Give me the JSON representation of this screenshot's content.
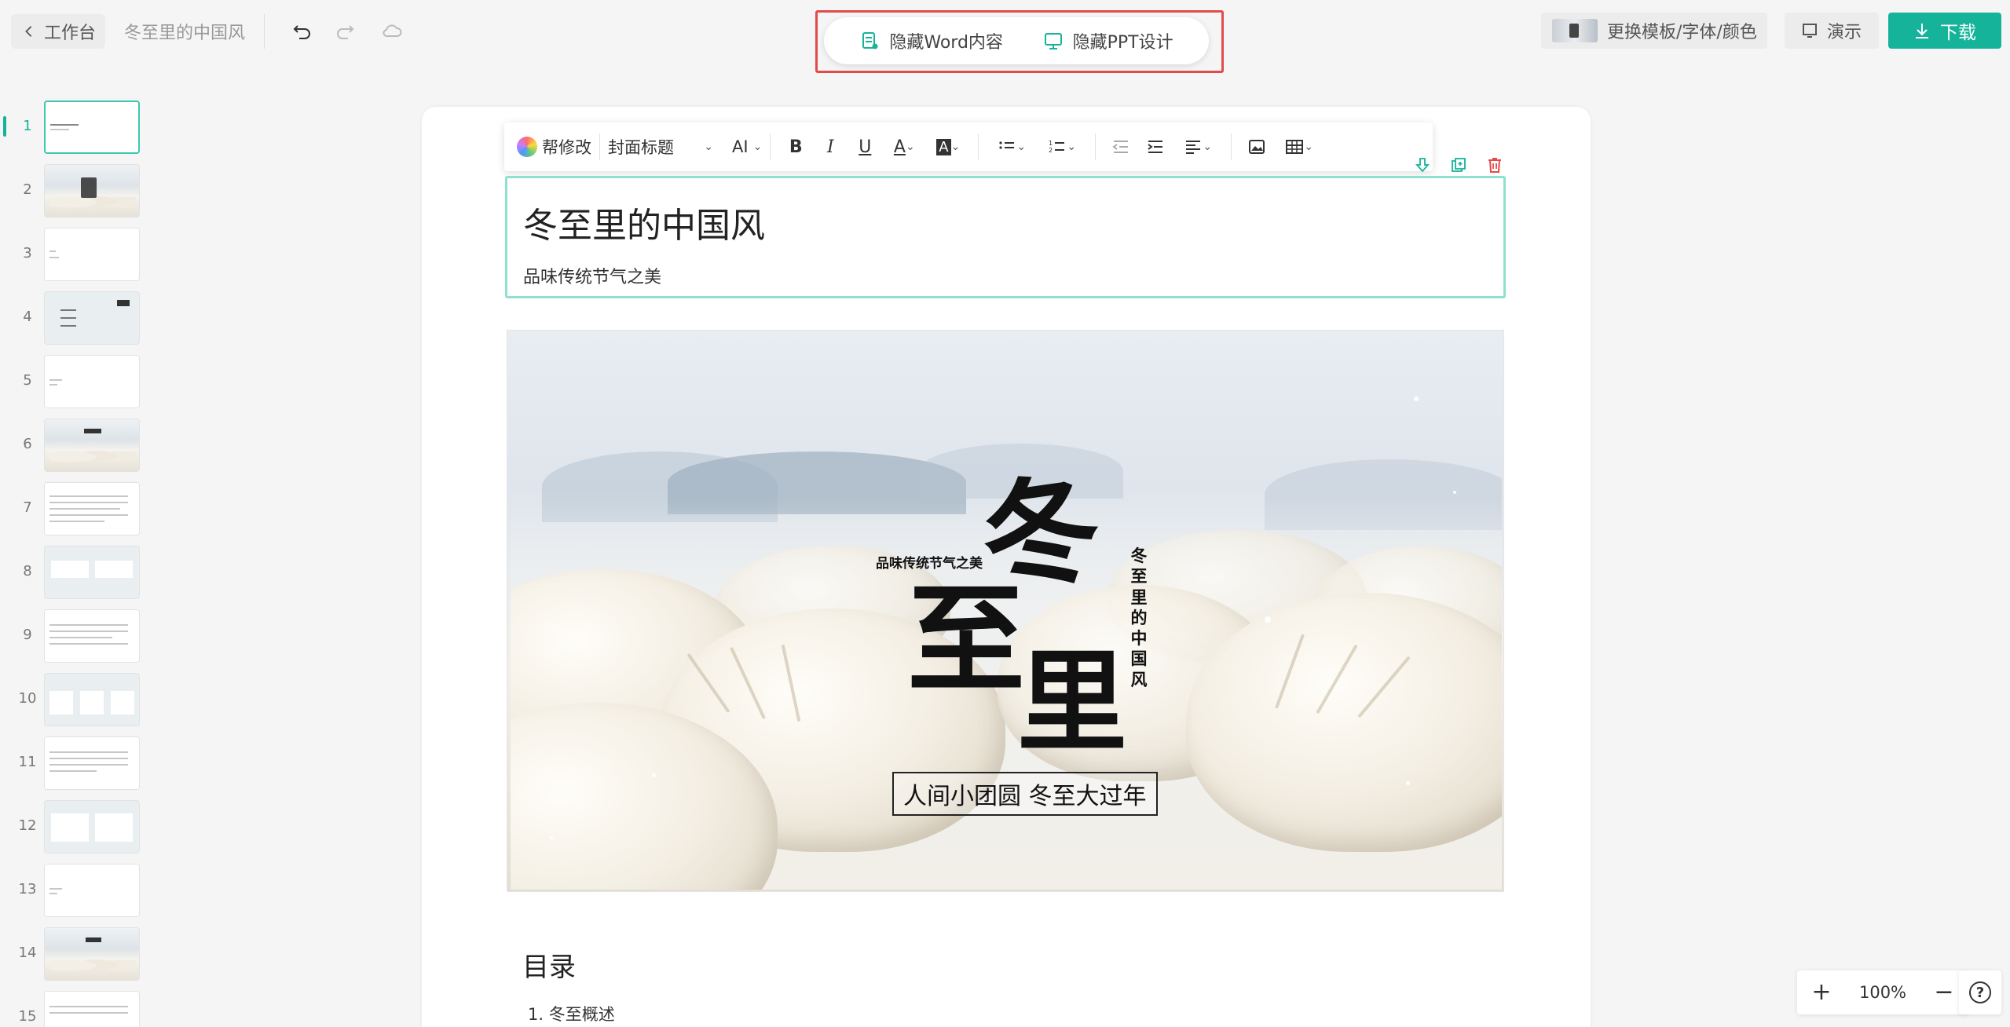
{
  "header": {
    "back_label": "工作台",
    "doc_title": "冬至里的中国风",
    "toggle_word": "隐藏Word内容",
    "toggle_ppt": "隐藏PPT设计",
    "template_label": "更换模板/字体/颜色",
    "present_label": "演示",
    "download_label": "下载"
  },
  "thumbnails": {
    "active_index": 1,
    "numbers": [
      "1",
      "2",
      "3",
      "4",
      "5",
      "6",
      "7",
      "8",
      "9",
      "10",
      "11",
      "12",
      "13",
      "14",
      "15"
    ]
  },
  "toolbar": {
    "help_label": "帮修改",
    "style_select": "封面标题",
    "ai_label": "AI"
  },
  "document": {
    "title": "冬至里的中国风",
    "subtitle": "品味传统节气之美",
    "toc_heading": "目录",
    "toc_items": [
      "1. 冬至概述"
    ]
  },
  "cover": {
    "char_dong": "冬",
    "char_zhi": "至",
    "char_li": "里",
    "sub_text": "品味传统节气之美",
    "vertical_text": "冬至里的中国风",
    "tagline": "人间小团圆 冬至大过年"
  },
  "zoom": {
    "level": "100%"
  },
  "colors": {
    "accent": "#14b39a",
    "highlight_border": "#e34a4a",
    "selection_border": "#8ee0cf"
  }
}
